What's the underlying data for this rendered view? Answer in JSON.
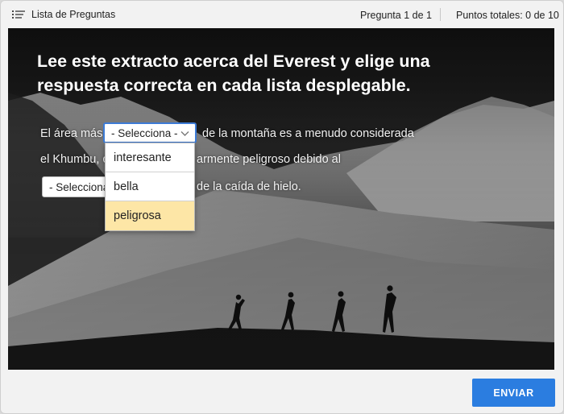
{
  "header": {
    "menu_label": "Lista de Preguntas",
    "question_counter": "Pregunta 1 de 1",
    "score": "Puntos totales: 0 de 10"
  },
  "question": {
    "title": "Lee este extracto acerca del Everest y elige una respuesta correcta en cada lista desplegable.",
    "line1_start": "El área más",
    "line1_end": "de la montaña es a menudo considerada",
    "line2_start": "el Khumbu, c",
    "line2_end": "armente peligroso debido al",
    "line3_end": "de la caída de hielo."
  },
  "select1": {
    "value": "- Selecciona -",
    "options": [
      "interesante",
      "bella",
      "peligrosa"
    ],
    "highlighted": "peligrosa"
  },
  "select2": {
    "value": "- Selecciona"
  },
  "footer": {
    "submit_label": "ENVIAR"
  },
  "colors": {
    "accent": "#2b7de0",
    "select_focus": "#3c7bd6",
    "option_highlight": "#fde6a6"
  }
}
